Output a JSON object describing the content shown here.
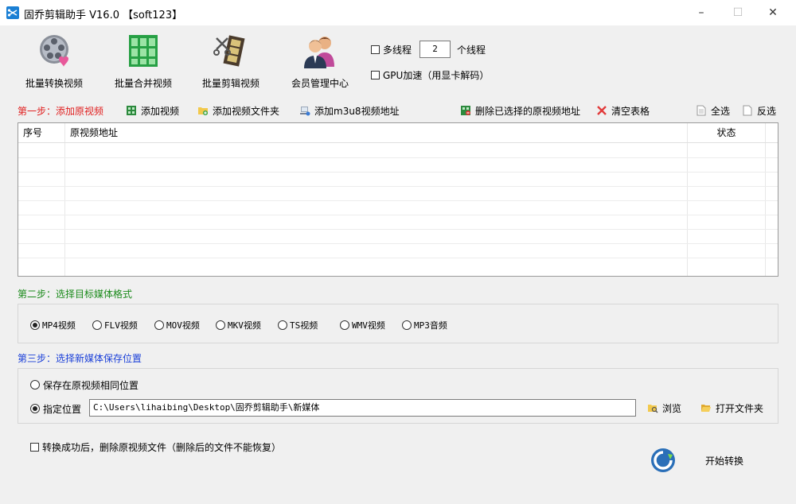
{
  "window": {
    "title": "固乔剪辑助手 V16.0 【soft123】",
    "minimize": "–",
    "maximize": "☐",
    "close": "✕"
  },
  "toolbar": {
    "items": [
      {
        "label": "批量转换视频",
        "icon": "film-reel-heart-icon"
      },
      {
        "label": "批量合并视频",
        "icon": "film-strip-merge-icon"
      },
      {
        "label": "批量剪辑视频",
        "icon": "film-scissors-icon"
      },
      {
        "label": "会员管理中心",
        "icon": "users-icon"
      }
    ],
    "multithread_label": "多线程",
    "thread_count": "2",
    "thread_unit": "个线程",
    "gpu_label": "GPU加速（用显卡解码）"
  },
  "step1": {
    "title": "第一步：添加原视频",
    "add_video": "添加视频",
    "add_folder": "添加视频文件夹",
    "add_m3u8": "添加m3u8视频地址",
    "delete_selected": "删除已选择的原视频地址",
    "clear_table": "清空表格",
    "select_all": "全选",
    "invert": "反选"
  },
  "table": {
    "columns": [
      "序号",
      "原视频地址",
      "状态"
    ],
    "rows": []
  },
  "step2": {
    "title": "第二步：选择目标媒体格式",
    "formats": [
      "MP4视频",
      "FLV视频",
      "MOV视频",
      "MKV视频",
      "TS视频",
      "WMV视频",
      "MP3音频"
    ],
    "selected": "MP4视频"
  },
  "step3": {
    "title": "第三步：选择新媒体保存位置",
    "option_same": "保存在原视频相同位置",
    "option_custom": "指定位置",
    "path": "C:\\Users\\lihaibing\\Desktop\\固乔剪辑助手\\新媒体",
    "browse": "浏览",
    "open_folder": "打开文件夹"
  },
  "footer": {
    "delete_after": "转换成功后，删除原视频文件（删除后的文件不能恢复）",
    "start": "开始转换"
  },
  "colors": {
    "step1": "#e02020",
    "step2": "#1a8a1a",
    "step3": "#1a3fd8"
  }
}
